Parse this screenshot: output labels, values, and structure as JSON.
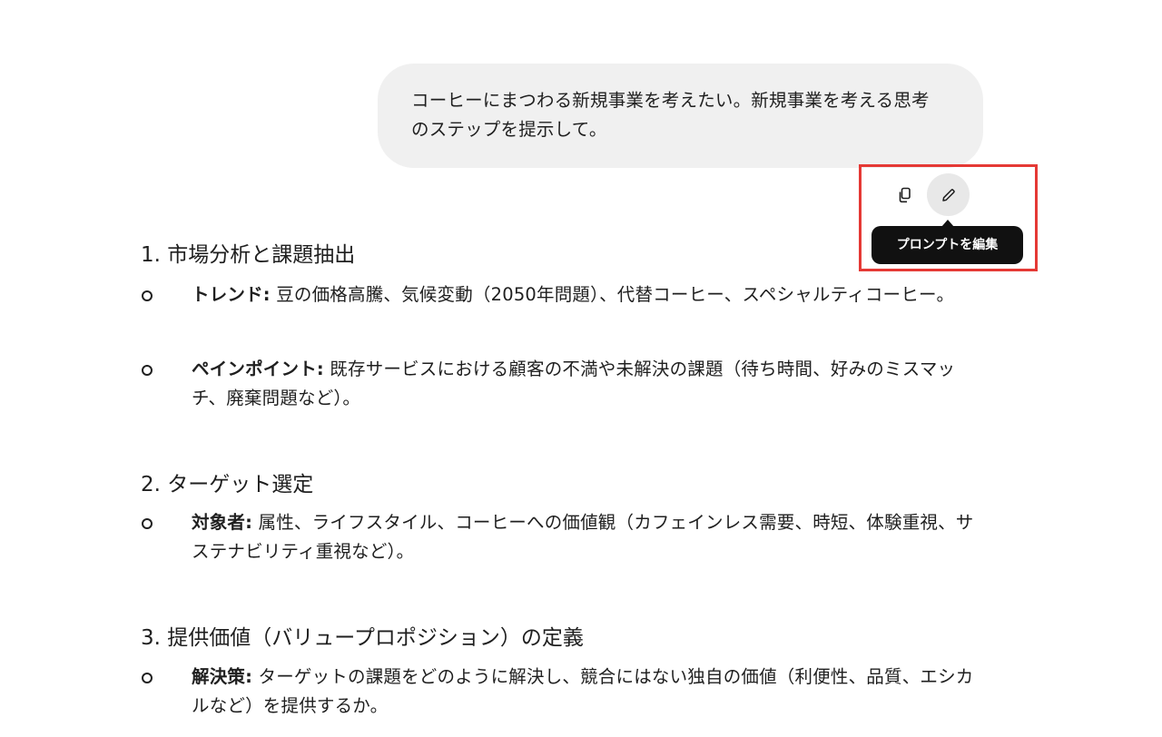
{
  "user_message": {
    "text": "コーヒーにまつわる新規事業を考えたい。新規事業を考える思考のステップを提示して。"
  },
  "actions": {
    "copy_icon": "copy-icon",
    "edit_icon": "pencil-icon",
    "tooltip": "プロンプトを編集"
  },
  "response": {
    "sections": [
      {
        "title": "1. 市場分析と課題抽出",
        "items": [
          {
            "label": "トレンド:",
            "text": " 豆の価格高騰、気候変動（2050年問題）、代替コーヒー、スペシャルティコーヒー。"
          },
          {
            "label": "ペインポイント:",
            "text": " 既存サービスにおける顧客の不満や未解決の課題（待ち時間、好みのミスマッチ、廃棄問題など）。"
          }
        ]
      },
      {
        "title": "2. ターゲット選定",
        "items": [
          {
            "label": "対象者:",
            "text": " 属性、ライフスタイル、コーヒーへの価値観（カフェインレス需要、時短、体験重視、サステナビリティ重視など）。"
          }
        ]
      },
      {
        "title": "3. 提供価値（バリュープロポジション）の定義",
        "items": [
          {
            "label": "解決策:",
            "text": " ターゲットの課題をどのように解決し、競合にはない独自の価値（利便性、品質、エシカルなど）を提供するか。"
          }
        ]
      }
    ]
  },
  "colors": {
    "highlight_border": "#e53935",
    "bubble_bg": "#f0f0f0",
    "tooltip_bg": "#111111"
  }
}
